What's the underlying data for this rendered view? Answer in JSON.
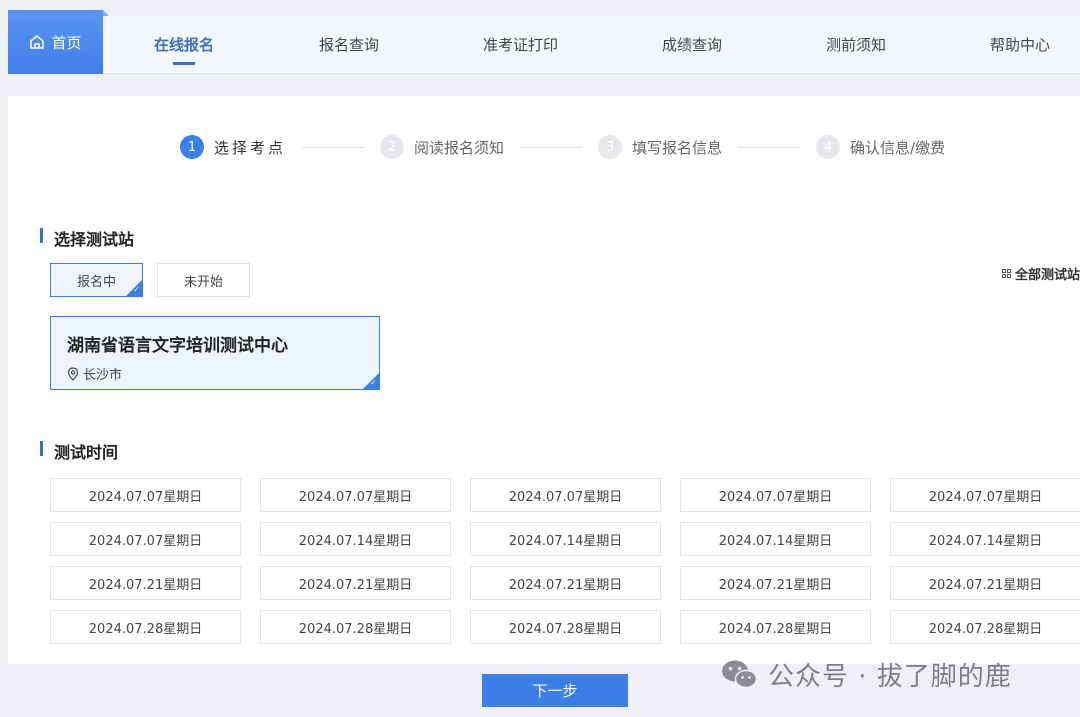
{
  "nav": {
    "home_label": "首页",
    "items": [
      {
        "label": "在线报名"
      },
      {
        "label": "报名查询"
      },
      {
        "label": "准考证打印"
      },
      {
        "label": "成绩查询"
      },
      {
        "label": "测前须知"
      },
      {
        "label": "帮助中心"
      }
    ],
    "active_index": 0
  },
  "steps": [
    {
      "num": "1",
      "label": "选择考点"
    },
    {
      "num": "2",
      "label": "阅读报名须知"
    },
    {
      "num": "3",
      "label": "填写报名信息"
    },
    {
      "num": "4",
      "label": "确认信息/缴费"
    }
  ],
  "station_section": {
    "title": "选择测试站",
    "tabs": [
      {
        "label": "报名中"
      },
      {
        "label": "未开始"
      }
    ],
    "all_stations_label": "全部测试站",
    "station": {
      "name": "湖南省语言文字培训测试中心",
      "city": "长沙市"
    }
  },
  "time_section": {
    "title": "测试时间",
    "dates": [
      "2024.07.07星期日",
      "2024.07.07星期日",
      "2024.07.07星期日",
      "2024.07.07星期日",
      "2024.07.07星期日",
      "2024.07.07星期日",
      "2024.07.14星期日",
      "2024.07.14星期日",
      "2024.07.14星期日",
      "2024.07.14星期日",
      "2024.07.21星期日",
      "2024.07.21星期日",
      "2024.07.21星期日",
      "2024.07.21星期日",
      "2024.07.21星期日",
      "2024.07.28星期日",
      "2024.07.28星期日",
      "2024.07.28星期日",
      "2024.07.28星期日",
      "2024.07.28星期日"
    ]
  },
  "footer": {
    "next_label": "下一步",
    "watermark": "公众号 · 拔了脚的鹿"
  },
  "colors": {
    "accent": "#3b7ee6",
    "nav_active": "#3f6fb8"
  }
}
